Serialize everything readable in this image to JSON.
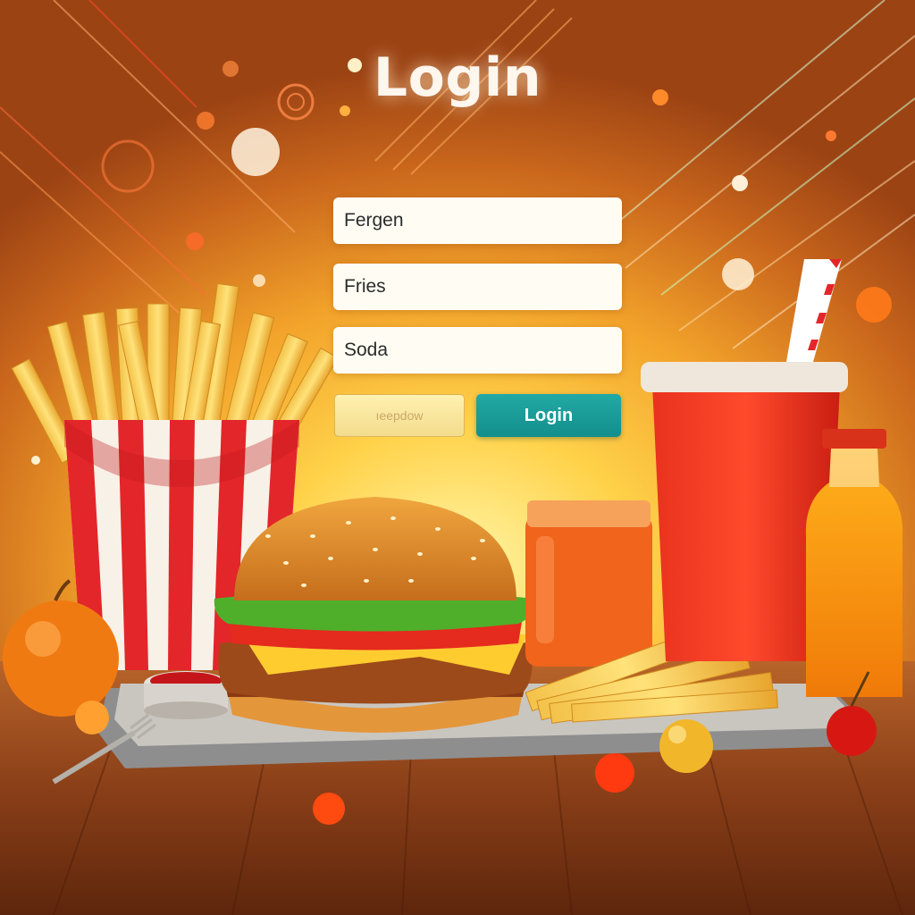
{
  "form": {
    "title": "Login",
    "fields": [
      {
        "value": "Fergen"
      },
      {
        "value": "Fries"
      },
      {
        "value": "Soda"
      }
    ],
    "secondary_button_label": "ıeepdow",
    "login_button_label": "Login"
  },
  "theme": {
    "accent": "#1ea19e",
    "field_bg": "#fffdf3",
    "background_warm": "#f2a22a"
  }
}
